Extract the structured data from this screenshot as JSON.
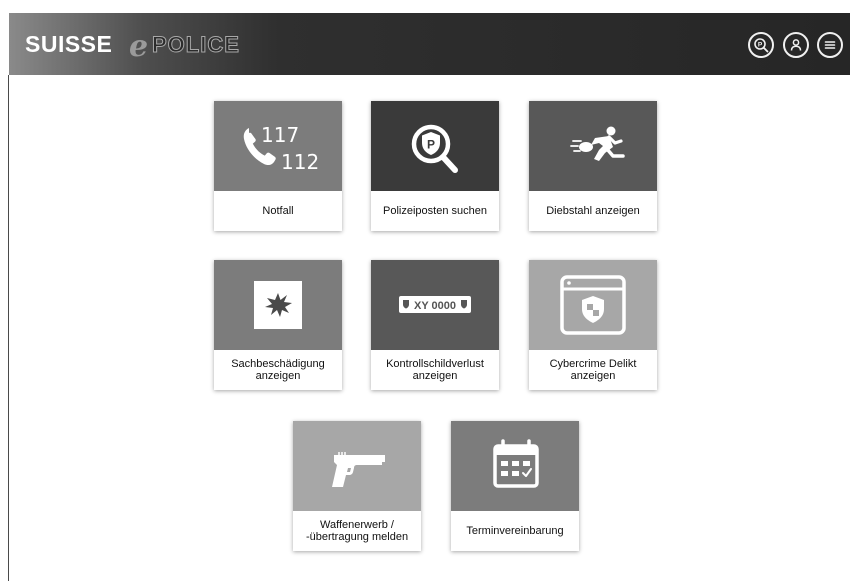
{
  "header": {
    "logo_suisse": "SUISSE",
    "logo_e": "e",
    "logo_police": "POLICE",
    "icons": [
      "police-station-search-icon",
      "user-icon",
      "menu-icon"
    ]
  },
  "tiles": [
    {
      "id": "notfall",
      "label": "Notfall",
      "icon": "phone-icon",
      "number1": "117",
      "number2": "112"
    },
    {
      "id": "polizeiposten",
      "label": "Polizeiposten suchen",
      "icon": "police-search-icon"
    },
    {
      "id": "diebstahl",
      "label": "Diebstahl anzeigen",
      "icon": "running-thief-icon"
    },
    {
      "id": "sachbeschaedigung",
      "label": "Sachbeschädigung anzeigen",
      "icon": "damage-icon"
    },
    {
      "id": "kontrollschild",
      "label": "Kontrollschildverlust anzeigen",
      "icon": "license-plate-icon",
      "plate": "XY 0000"
    },
    {
      "id": "cybercrime",
      "label": "Cybercrime Delikt anzeigen",
      "icon": "browser-shield-icon"
    },
    {
      "id": "waffen",
      "label": "Waffenerwerb / -übertragung melden",
      "icon": "pistol-icon"
    },
    {
      "id": "termin",
      "label": "Terminvereinbarung",
      "icon": "calendar-icon"
    }
  ],
  "colors": {
    "header_bg": "#262626",
    "tile_dark": "#3a3a3a",
    "tile_mid": "#585858",
    "tile_gray": "#7c7c7c",
    "tile_light": "#a7a7a7"
  }
}
